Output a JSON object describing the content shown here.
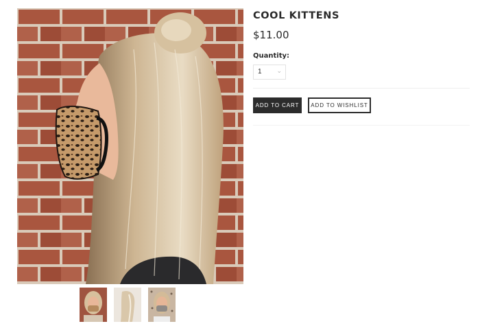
{
  "product": {
    "title": "COOL KITTENS",
    "price": "$11.00",
    "quantity_label": "Quantity:",
    "quantity_value": "1",
    "add_to_cart_label": "ADD TO CART",
    "add_to_wishlist_label": "ADD TO WISHLIST"
  },
  "images": {
    "main_alt": "woman wearing leopard print face mask in front of brick wall",
    "thumbnails": [
      {
        "alt": "front view with mask"
      },
      {
        "alt": "side view hair"
      },
      {
        "alt": "front view with mask variant"
      }
    ]
  },
  "icons": {
    "quantity_chevron": "chevron-down-icon"
  },
  "colors": {
    "button_dark": "#2c2c2c",
    "brick": "#a9553f",
    "mortar": "#d8c9b8",
    "hair": "#d8c3a4"
  }
}
